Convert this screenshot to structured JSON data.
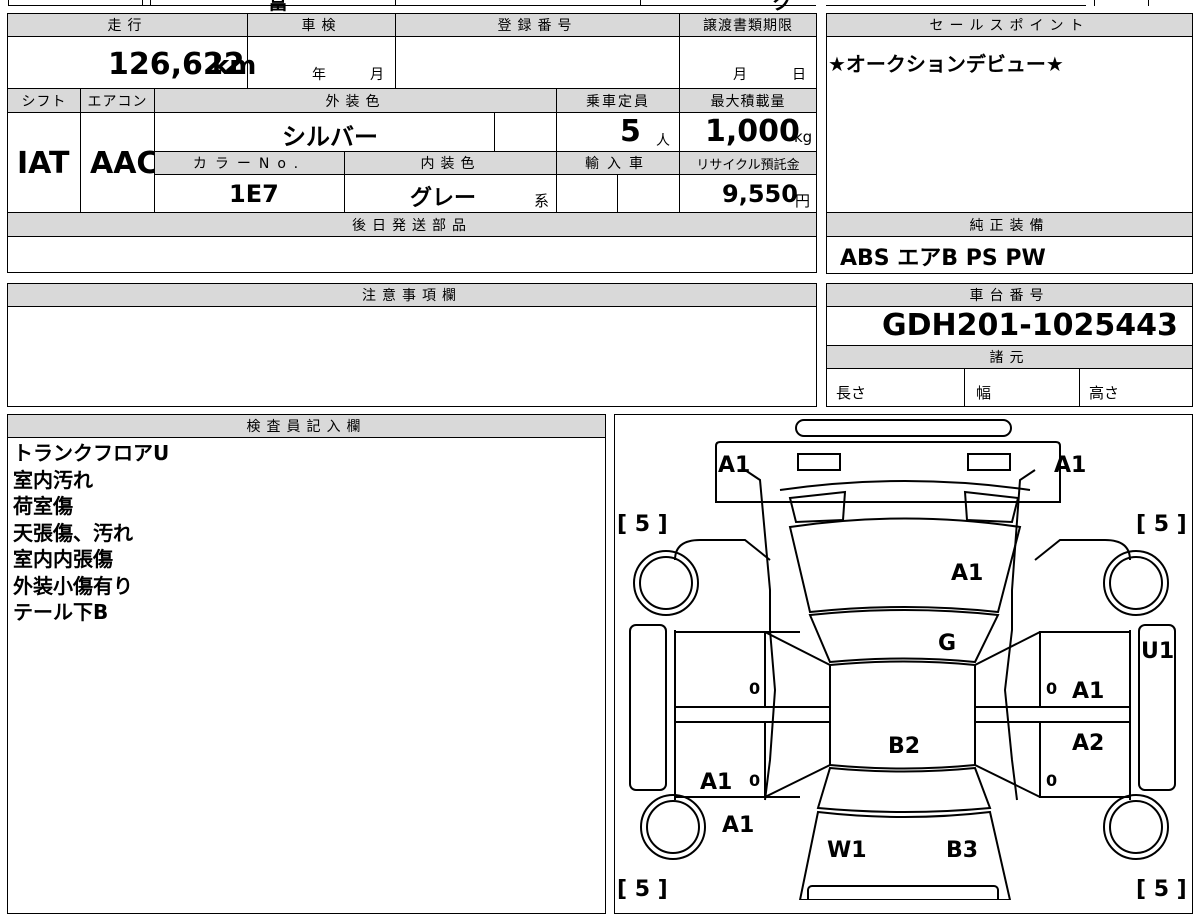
{
  "top_strip": {
    "fragment_left": "富",
    "fragment_right": "ク"
  },
  "mileage": {
    "label": "走行",
    "value": "126,622",
    "unit": "km"
  },
  "inspection": {
    "label": "車検",
    "year": "年",
    "month": "月"
  },
  "registration": {
    "label": "登録番号",
    "value": ""
  },
  "transfer_deadline": {
    "label": "譲渡書類期限",
    "month": "月",
    "day": "日"
  },
  "shift": {
    "label": "シフト",
    "value": "IAT"
  },
  "aircon": {
    "label": "エアコン",
    "value": "AAC"
  },
  "exterior_color": {
    "label": "外装色",
    "value": "シルバー"
  },
  "capacity": {
    "label": "乗車定員",
    "value": "5",
    "unit": "人"
  },
  "max_load": {
    "label": "最大積載量",
    "value": "1,000",
    "unit": "kg"
  },
  "color_no": {
    "label": "カラーNo.",
    "value": "1E7"
  },
  "interior_color": {
    "label": "内装色",
    "value": "グレー",
    "suffix": "系"
  },
  "import": {
    "label": "輸入車",
    "value": ""
  },
  "recycle": {
    "label": "リサイクル預託金",
    "value": "9,550",
    "unit": "円"
  },
  "later_parts": {
    "label": "後日発送部品",
    "value": ""
  },
  "sales_point": {
    "label": "セールスポイント",
    "value": "★オークションデビュー★"
  },
  "equipment": {
    "label": "純正装備",
    "value": "ABS エアB PS PW"
  },
  "notes": {
    "label": "注意事項欄",
    "value": ""
  },
  "chassis": {
    "label": "車台番号",
    "value": "GDH201-1025443"
  },
  "specs": {
    "label": "諸元",
    "length": "長さ",
    "width": "幅",
    "height": "高さ"
  },
  "inspector": {
    "label": "検査員記入欄",
    "lines": [
      "トランクフロアU",
      "室内汚れ",
      "荷室傷",
      "天張傷、汚れ",
      "室内内張傷",
      "外装小傷有り",
      "テール下B"
    ]
  },
  "diagram": {
    "tire_depth": {
      "front_left": "[ 5 ]",
      "front_right": "[ 5 ]",
      "rear_left": "[ 5 ]",
      "rear_right": "[ 5 ]"
    },
    "marks": {
      "rear_left_corner": "A1",
      "rear_right_corner": "A1",
      "roof_rear": "A1",
      "back_glass": "G",
      "right_side": "U1",
      "right_door_upper": "A1",
      "right_door_lower": "A2",
      "roof": "B2",
      "left_door_lower": "A1",
      "left_front": "A1",
      "windshield": "W1",
      "hood": "B3",
      "left_upper_zero": "0",
      "left_lower_zero": "0",
      "right_upper_zero": "0",
      "right_lower_zero": "0"
    }
  }
}
